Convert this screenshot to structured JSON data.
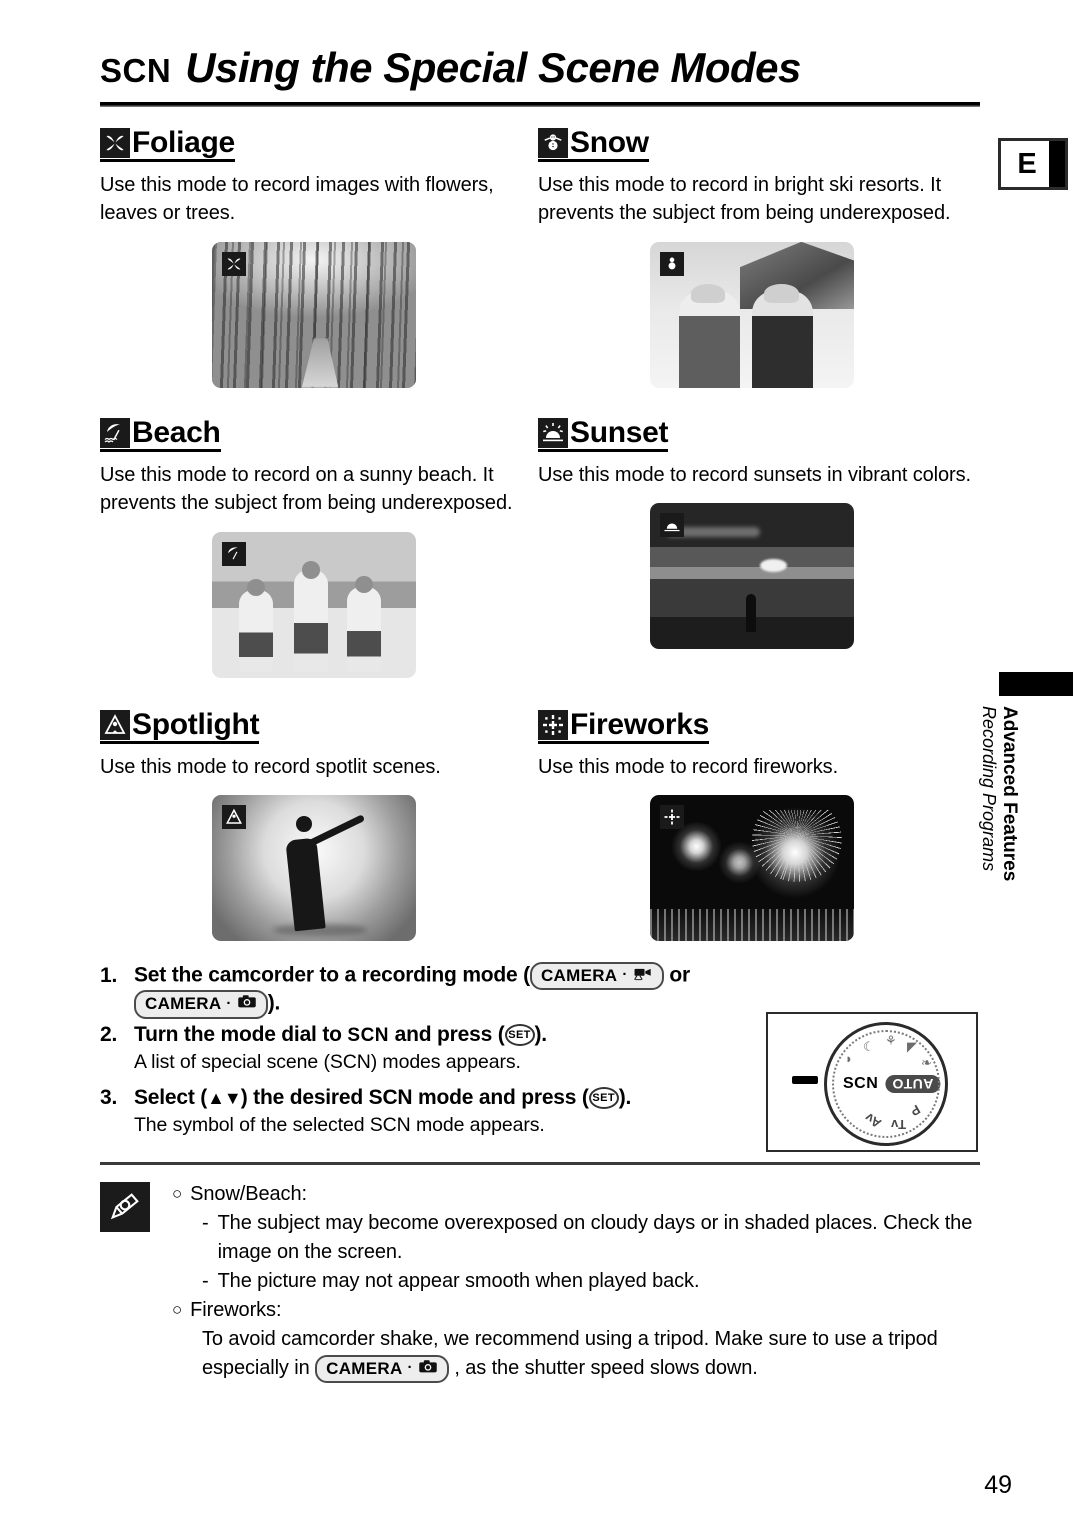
{
  "header": {
    "scn_tag": "SCN",
    "title": "Using the Special Scene Modes"
  },
  "modes": [
    {
      "name": "Foliage",
      "icon": "foliage-leaf-icon",
      "description": "Use this mode to record images with flowers, leaves or trees.",
      "photo_alt": "forest path with leafy trees"
    },
    {
      "name": "Snow",
      "icon": "snowman-icon",
      "description": "Use this mode to record in bright ski resorts. It prevents the subject from being underexposed.",
      "photo_alt": "two people in winter clothing at a ski lodge"
    },
    {
      "name": "Beach",
      "icon": "beach-umbrella-icon",
      "description": "Use this mode to record on a sunny beach. It prevents the subject from being underexposed.",
      "photo_alt": "three children playing on a sunny beach"
    },
    {
      "name": "Sunset",
      "icon": "sunset-icon",
      "description": "Use this mode to record sunsets in vibrant colors.",
      "photo_alt": "silhouette of a person at sunset over water"
    },
    {
      "name": "Spotlight",
      "icon": "spotlight-icon",
      "description": "Use this mode to record spotlit scenes.",
      "photo_alt": "figure skater under a spotlight"
    },
    {
      "name": "Fireworks",
      "icon": "fireworks-icon",
      "description": "Use this mode to record fireworks.",
      "photo_alt": "fireworks bursting over a city skyline"
    }
  ],
  "side_tabs": {
    "language_letter": "E",
    "section_title": "Advanced Features",
    "section_subtitle": "Recording Programs"
  },
  "steps": [
    {
      "number": "1.",
      "text_before": "Set the camcorder to a recording mode (",
      "badge_1": "CAMERA",
      "badge_1_icon": "movie-camera-icon",
      "between": "or",
      "badge_2": "CAMERA",
      "badge_2_icon": "still-camera-icon",
      "text_after": ")."
    },
    {
      "number": "2.",
      "text_before": "Turn the mode dial to",
      "mode_label": "SCN",
      "text_mid": "and press (",
      "set_key": "SET",
      "text_after": ").",
      "sub": "A list of special scene (SCN) modes appears."
    },
    {
      "number": "3.",
      "text_before": "Select (",
      "arrows": "▲▼",
      "text_mid": ") the desired SCN mode and press (",
      "set_key": "SET",
      "text_after": ").",
      "sub": "The symbol of the selected SCN mode appears."
    }
  ],
  "mode_dial": {
    "selected_label": "SCN",
    "auto_label": "AUTO",
    "letters": [
      "P",
      "Tv",
      "Av"
    ],
    "icons": [
      "portrait-icon",
      "sports-icon",
      "night-icon",
      "snow-icon",
      "beach-icon"
    ]
  },
  "notes": {
    "icon": "pencil-note-icon",
    "groups": [
      {
        "title": "Snow/Beach:",
        "bullet": "○",
        "items": [
          "The subject may become overexposed on cloudy days or in shaded places. Check the image on the screen.",
          "The picture may not appear smooth when played back."
        ]
      },
      {
        "title": "Fireworks:",
        "bullet": "○",
        "paragraph_before": "To avoid camcorder shake, we recommend using a tripod. Make sure to use a tripod especially in",
        "badge": "CAMERA",
        "badge_icon": "still-camera-icon",
        "paragraph_after": ", as the shutter speed slows down."
      }
    ]
  },
  "footer": {
    "page_number": "49"
  },
  "colors": {
    "ink": "#000000",
    "paper": "#ffffff",
    "badge_fill": "#ededed",
    "icon_bg": "#1a1a1a"
  }
}
